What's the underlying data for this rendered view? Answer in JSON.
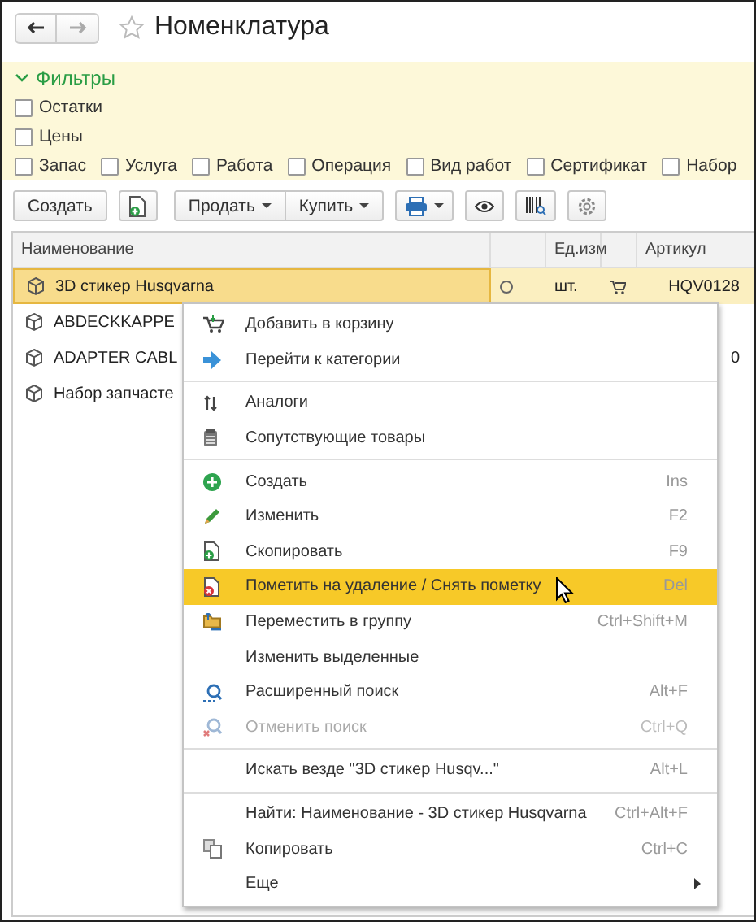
{
  "window": {
    "title": "Номенклатура",
    "favorite": false
  },
  "filters": {
    "title": "Фильтры",
    "expanded": true,
    "lines": [
      {
        "items": [
          {
            "label": "Остатки",
            "checked": false
          }
        ]
      },
      {
        "items": [
          {
            "label": "Цены",
            "checked": false
          }
        ]
      },
      {
        "items": [
          {
            "label": "Запас",
            "checked": false
          },
          {
            "label": "Услуга",
            "checked": false
          },
          {
            "label": "Работа",
            "checked": false
          },
          {
            "label": "Операция",
            "checked": false
          },
          {
            "label": "Вид работ",
            "checked": false
          },
          {
            "label": "Сертификат",
            "checked": false
          },
          {
            "label": "Набор",
            "checked": false
          }
        ]
      }
    ]
  },
  "toolbar": {
    "create": "Создать",
    "sell": "Продать",
    "buy": "Купить"
  },
  "table": {
    "columns": [
      "Наименование",
      "",
      "Ед.изм",
      "",
      "Артикул"
    ],
    "rows": [
      {
        "name": "3D стикер Husqvarna",
        "unit": "шт.",
        "article": "HQV0128",
        "selected": true
      },
      {
        "name": "ABDECKKAPPE",
        "unit": "",
        "article": "",
        "selected": false
      },
      {
        "name": "ADAPTER CABL",
        "unit": "",
        "article": "0",
        "selected": false
      },
      {
        "name": "Набор запчасте",
        "unit": "",
        "article": "",
        "selected": false
      }
    ]
  },
  "context_menu": {
    "groups": [
      [
        {
          "label": "Добавить в корзину",
          "selected": false,
          "disabled": false
        },
        {
          "label": "Перейти к категории",
          "selected": false,
          "disabled": false
        }
      ],
      [
        {
          "label": "Аналоги",
          "selected": false,
          "disabled": false
        },
        {
          "label": "Сопутствующие товары",
          "selected": false,
          "disabled": false
        }
      ],
      [
        {
          "label": "Создать",
          "shortcut": "Ins",
          "selected": false,
          "disabled": false
        },
        {
          "label": "Изменить",
          "shortcut": "F2",
          "selected": false,
          "disabled": false
        },
        {
          "label": "Скопировать",
          "shortcut": "F9",
          "selected": false,
          "disabled": false
        },
        {
          "label": "Пометить на удаление / Снять пометку",
          "shortcut": "Del",
          "selected": true,
          "disabled": false
        },
        {
          "label": "Переместить в группу",
          "shortcut": "Ctrl+Shift+M",
          "selected": false,
          "disabled": false
        },
        {
          "label": "Изменить выделенные",
          "selected": false,
          "disabled": false
        },
        {
          "label": "Расширенный поиск",
          "shortcut": "Alt+F",
          "selected": false,
          "disabled": false
        },
        {
          "label": "Отменить поиск",
          "shortcut": "Ctrl+Q",
          "selected": false,
          "disabled": true
        }
      ],
      [
        {
          "label": "Искать везде \"3D стикер Husqv...\"",
          "shortcut": "Alt+L",
          "selected": false,
          "disabled": false
        }
      ],
      [
        {
          "label": "Найти: Наименование - 3D стикер Husqvarna",
          "shortcut": "Ctrl+Alt+F",
          "selected": false,
          "disabled": false
        },
        {
          "label": "Копировать",
          "shortcut": "Ctrl+C",
          "selected": false,
          "disabled": false
        },
        {
          "label": "Еще",
          "selected": false,
          "disabled": false,
          "submenu": true
        }
      ]
    ]
  }
}
